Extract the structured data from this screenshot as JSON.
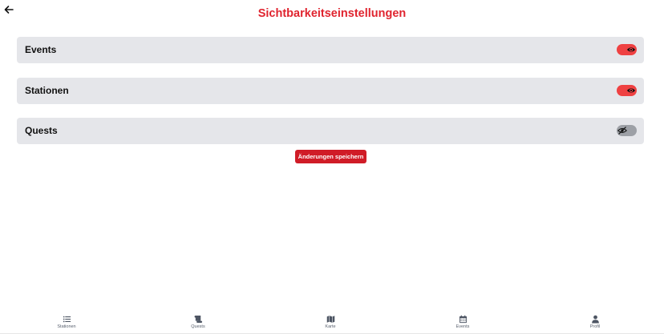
{
  "header": {
    "title": "Sichtbarkeitseinstellungen",
    "back_icon": "arrow-left-icon"
  },
  "settings": [
    {
      "label": "Events",
      "visible": true
    },
    {
      "label": "Stationen",
      "visible": true
    },
    {
      "label": "Quests",
      "visible": false
    }
  ],
  "save_button_label": "Änderungen speichern",
  "colors": {
    "accent": "#e0242f",
    "toggle_on": "#ef4142",
    "toggle_off": "#9da0a6",
    "row_background": "#e5e6ea",
    "button": "#d01c27"
  },
  "bottom_nav": [
    {
      "label": "Stationen",
      "icon": "list-icon"
    },
    {
      "label": "Quests",
      "icon": "scroll-icon"
    },
    {
      "label": "Karte",
      "icon": "map-icon"
    },
    {
      "label": "Events",
      "icon": "calendar-icon"
    },
    {
      "label": "Profil",
      "icon": "user-icon"
    }
  ]
}
